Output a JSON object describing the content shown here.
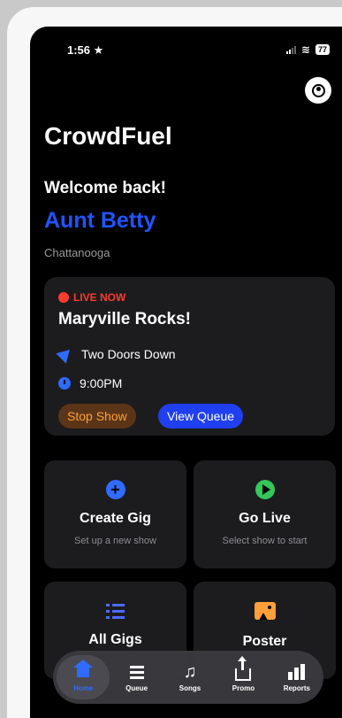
{
  "status_bar": {
    "time": "1:56",
    "time_suffix": "★",
    "battery": "77"
  },
  "header": {
    "app_title": "CrowdFuel",
    "welcome": "Welcome back!",
    "user_name": "Aunt Betty",
    "city": "Chattanooga"
  },
  "live_card": {
    "badge": "LIVE NOW",
    "title": "Maryville Rocks!",
    "venue": "Two Doors Down",
    "time": "9:00PM",
    "stop_button": "Stop Show",
    "queue_button": "View Queue"
  },
  "tiles": {
    "create_gig": {
      "title": "Create Gig",
      "subtitle": "Set up a new show"
    },
    "go_live": {
      "title": "Go Live",
      "subtitle": "Select show to start"
    },
    "all_gigs": {
      "title": "All Gigs"
    },
    "poster": {
      "title": "Poster"
    }
  },
  "tabbar": {
    "home": "Home",
    "queue": "Queue",
    "songs": "Songs",
    "promo": "Promo",
    "reports": "Reports"
  },
  "colors": {
    "accent_blue": "#1f54ff",
    "live_red": "#ff3b30",
    "stop_orange": "#ff9f3a",
    "go_green": "#34c759",
    "card_bg": "#1c1c1e"
  },
  "icons": [
    "profile-icon",
    "location-arrow-icon",
    "clock-icon",
    "plus-icon",
    "play-icon",
    "list-icon",
    "poster-image-icon",
    "home-icon",
    "queue-icon",
    "songs-icon",
    "promo-share-icon",
    "reports-chart-icon"
  ]
}
